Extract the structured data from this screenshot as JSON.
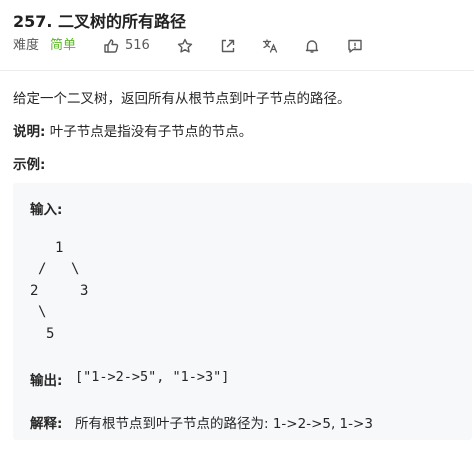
{
  "problem": {
    "title": "257. 二叉树的所有路径",
    "difficulty_label": "难度",
    "difficulty": "简单",
    "likes": "516"
  },
  "icons": {
    "like": "thumbs-up-icon",
    "favorite": "star-icon",
    "share": "share-icon",
    "translate": "translate-icon",
    "notify": "bell-icon",
    "feedback": "feedback-icon"
  },
  "description": {
    "main": "给定一个二叉树，返回所有从根节点到叶子节点的路径。",
    "note_label": "说明:",
    "note_text": " 叶子节点是指没有子节点的节点。",
    "example_heading": "示例:"
  },
  "example": {
    "input_label": "输入:",
    "tree": {
      "root": "1",
      "left_edge": "/",
      "right_edge": "\\",
      "left": "2",
      "right": "3",
      "left_right_edge": "\\",
      "left_right": "5"
    },
    "output_label": "输出:",
    "output_value": "[\"1->2->5\", \"1->3\"]",
    "explanation_label": "解释:",
    "explanation_text": "所有根节点到叶子节点的路径为: 1->2->5, 1->3"
  },
  "colors": {
    "difficulty_easy": "#5ab726",
    "example_bg": "#f7f8fa",
    "text": "#262626"
  }
}
